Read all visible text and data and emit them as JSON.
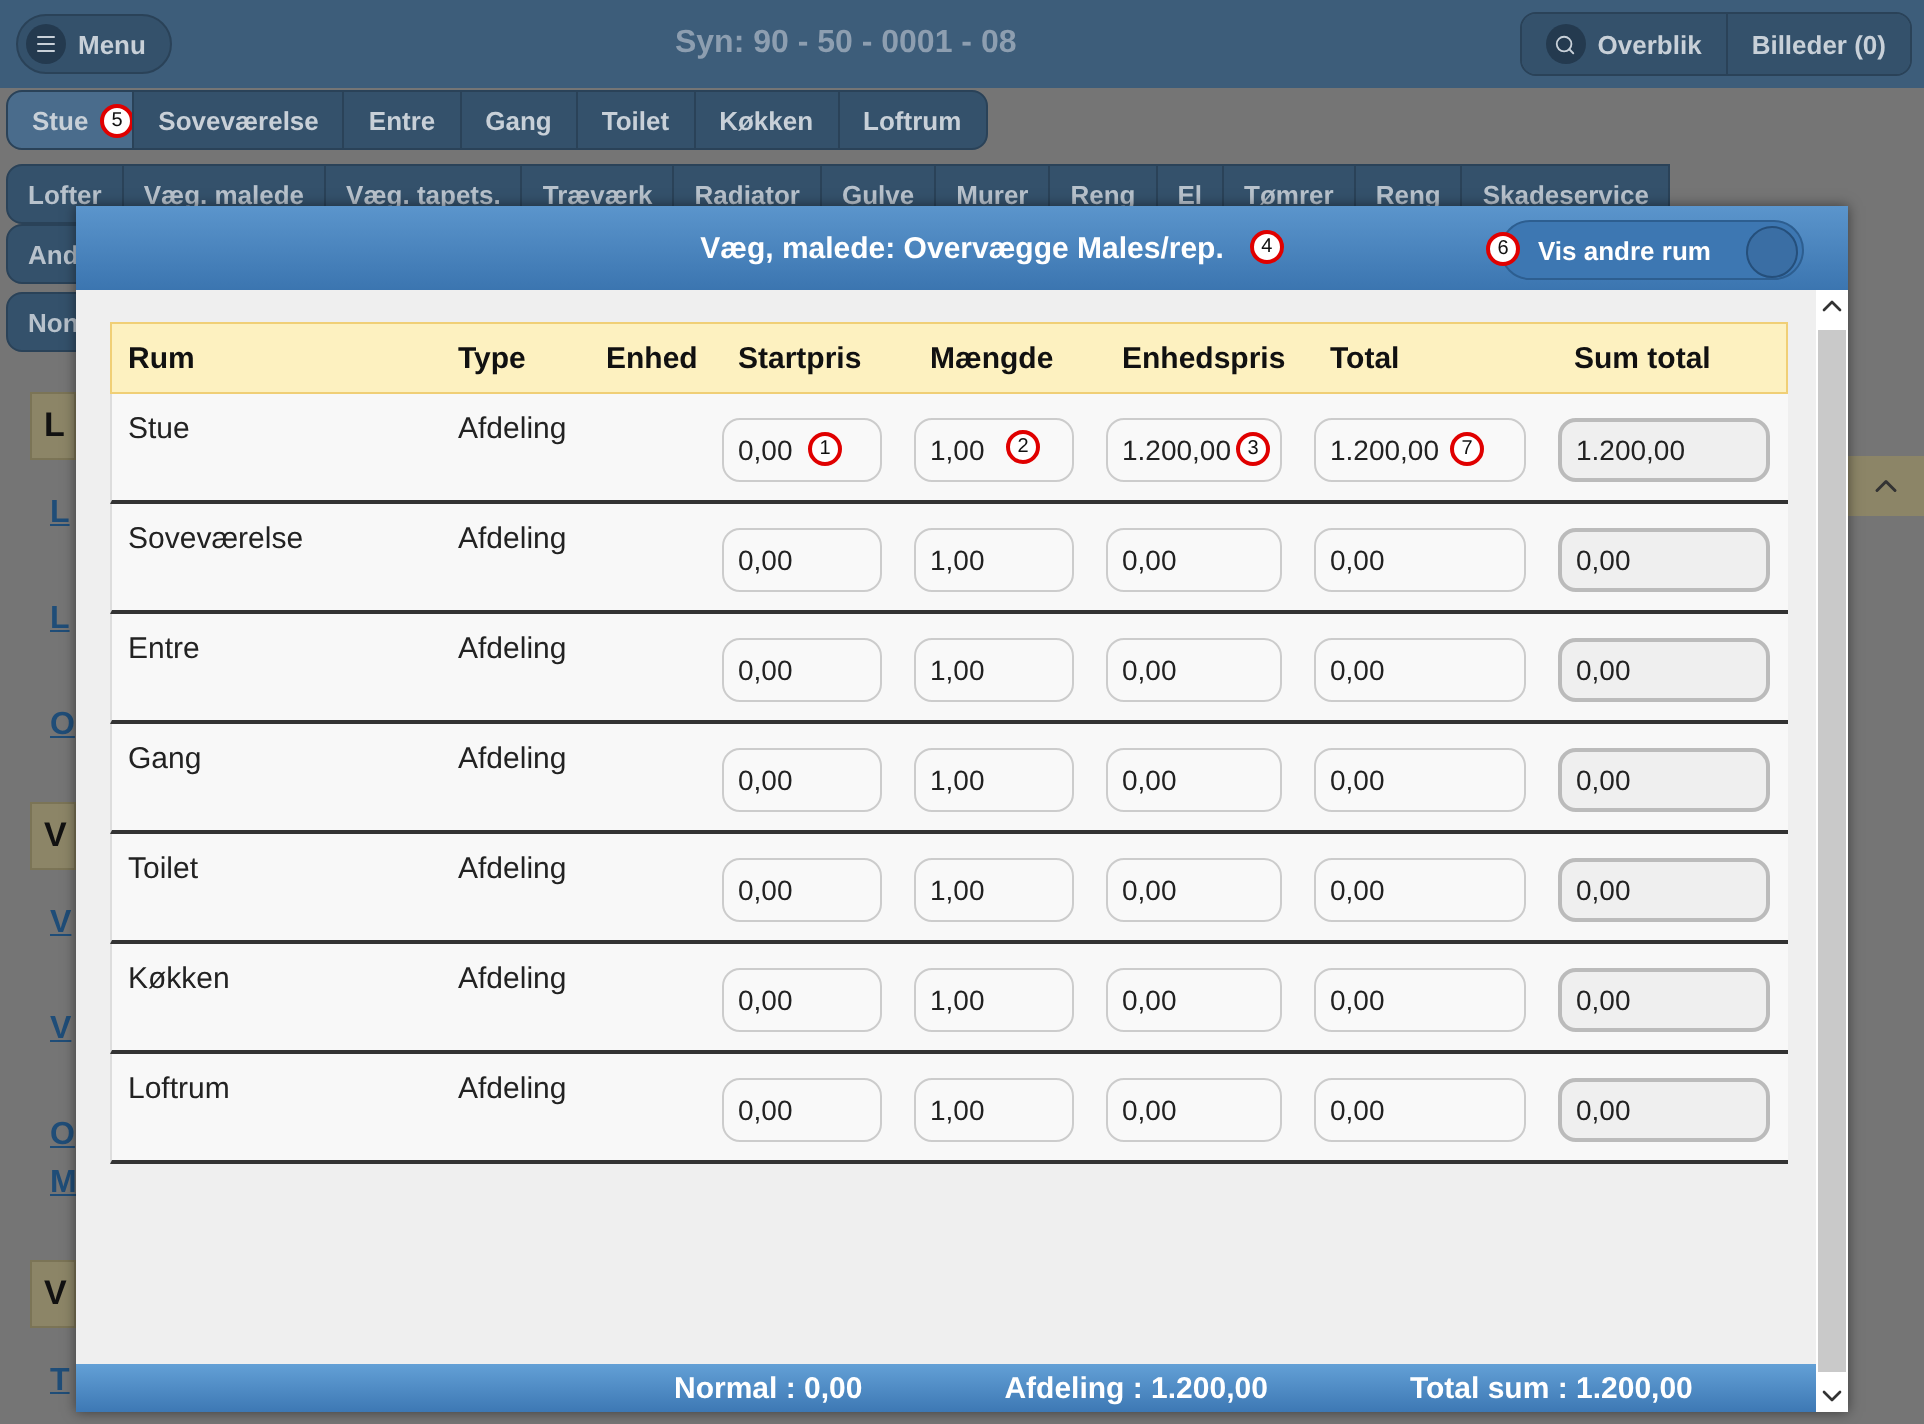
{
  "top_bar": {
    "menu_button": "Menu",
    "title": "Syn: 90 - 50 - 0001 - 08",
    "overview_button": "Overblik",
    "pictures_button": "Billeder (0)"
  },
  "room_tabs": [
    {
      "label": "Stue",
      "selected": true,
      "annotation": "5"
    },
    {
      "label": "Soveværelse",
      "selected": false
    },
    {
      "label": "Entre",
      "selected": false
    },
    {
      "label": "Gang",
      "selected": false
    },
    {
      "label": "Toilet",
      "selected": false
    },
    {
      "label": "Køkken",
      "selected": false
    },
    {
      "label": "Loftrum",
      "selected": false
    }
  ],
  "category_tabs": [
    "Lofter",
    "Væg. malede",
    "Væg. tapets.",
    "Træværk",
    "Radiator",
    "Gulve",
    "Murer",
    "Reng",
    "El",
    "Tømrer",
    "Reng",
    "Skadeservice"
  ],
  "category_tabs_row_2": [
    "And"
  ],
  "category_tabs_row_3": [
    "Non"
  ],
  "side_list": [
    {
      "kind": "header",
      "text": "L"
    },
    {
      "kind": "link",
      "text": "L"
    },
    {
      "kind": "link",
      "text": "L"
    },
    {
      "kind": "link",
      "text": "O"
    },
    {
      "kind": "header",
      "text": "V"
    },
    {
      "kind": "link",
      "text": "V"
    },
    {
      "kind": "link",
      "text": "V"
    },
    {
      "kind": "link2",
      "text": "O",
      "text_2": "M"
    },
    {
      "kind": "header",
      "text": "V"
    },
    {
      "kind": "link",
      "text": "T"
    }
  ],
  "dialog": {
    "title": "Væg, malede: Overvægge Males/rep.",
    "title_annotation": "4",
    "toggle": {
      "label": "Vis andre rum",
      "on": true,
      "annotation": "6"
    },
    "columns": [
      "Rum",
      "Type",
      "Enhed",
      "Startpris",
      "Mængde",
      "Enhedspris",
      "Total",
      "Sum total"
    ],
    "rows": [
      {
        "room": "Stue",
        "type": "Afdeling",
        "fields": [
          {
            "value": "0,00",
            "annotation": "1"
          },
          {
            "value": "1,00",
            "annotation": "2"
          },
          {
            "value": "1.200,00",
            "annotation": "3"
          },
          {
            "value": "1.200,00",
            "annotation": "7"
          },
          {
            "value": "1.200,00"
          }
        ]
      },
      {
        "room": "Soveværelse",
        "type": "Afdeling",
        "fields": [
          {
            "value": "0,00"
          },
          {
            "value": "1,00"
          },
          {
            "value": "0,00"
          },
          {
            "value": "0,00"
          },
          {
            "value": "0,00"
          }
        ]
      },
      {
        "room": "Entre",
        "type": "Afdeling",
        "fields": [
          {
            "value": "0,00"
          },
          {
            "value": "1,00"
          },
          {
            "value": "0,00"
          },
          {
            "value": "0,00"
          },
          {
            "value": "0,00"
          }
        ]
      },
      {
        "room": "Gang",
        "type": "Afdeling",
        "fields": [
          {
            "value": "0,00"
          },
          {
            "value": "1,00"
          },
          {
            "value": "0,00"
          },
          {
            "value": "0,00"
          },
          {
            "value": "0,00"
          }
        ]
      },
      {
        "room": "Toilet",
        "type": "Afdeling",
        "fields": [
          {
            "value": "0,00"
          },
          {
            "value": "1,00"
          },
          {
            "value": "0,00"
          },
          {
            "value": "0,00"
          },
          {
            "value": "0,00"
          }
        ]
      },
      {
        "room": "Køkken",
        "type": "Afdeling",
        "fields": [
          {
            "value": "0,00"
          },
          {
            "value": "1,00"
          },
          {
            "value": "0,00"
          },
          {
            "value": "0,00"
          },
          {
            "value": "0,00"
          }
        ]
      },
      {
        "room": "Loftrum",
        "type": "Afdeling",
        "fields": [
          {
            "value": "0,00"
          },
          {
            "value": "1,00"
          },
          {
            "value": "0,00"
          },
          {
            "value": "0,00"
          },
          {
            "value": "0,00"
          }
        ]
      }
    ],
    "footer": [
      "Normal : 0,00",
      "Afdeling : 1.200,00",
      "Total sum : 1.200,00"
    ]
  }
}
